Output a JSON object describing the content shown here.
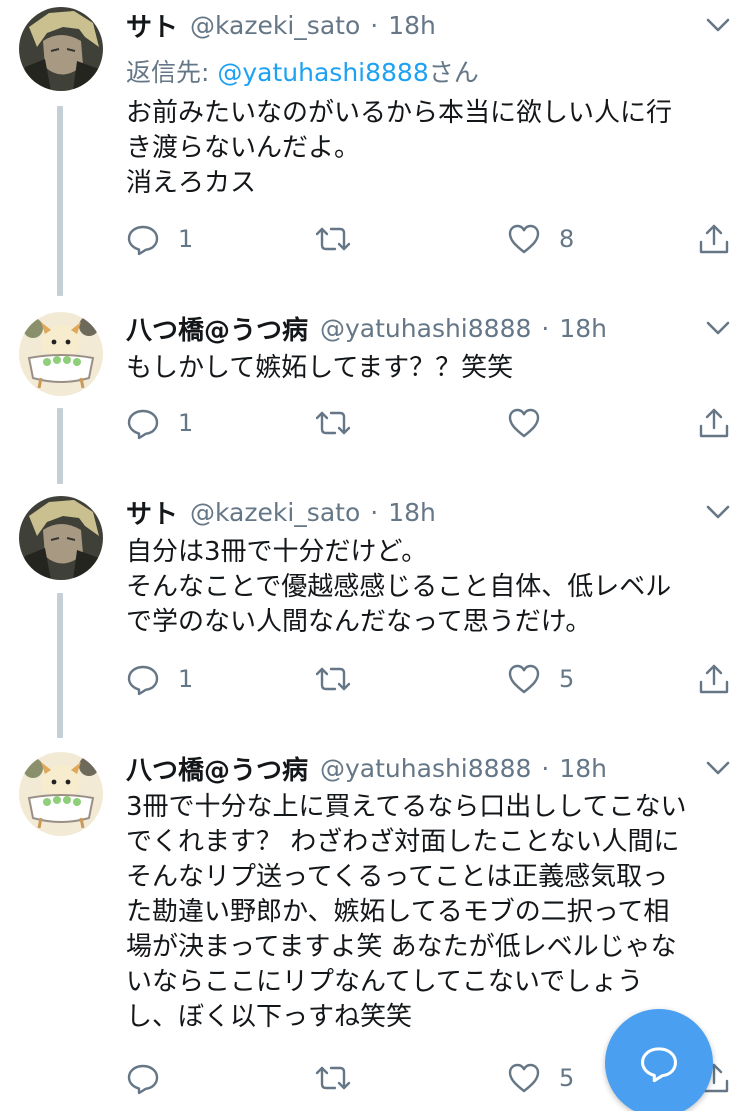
{
  "tweets": [
    {
      "display_name": "サト",
      "handle": "@kazeki_sato",
      "separator": "·",
      "time": "18h",
      "reply_to_prefix": "返信先: ",
      "reply_to_mention": "@yatuhashi8888",
      "reply_to_suffix": "さん",
      "text_lines": [
        "お前みたいなのがいるから本当に欲しい人に行",
        "き渡らないんだよ。",
        "消えろカス"
      ],
      "reply_count": "1",
      "retweet_count": "",
      "like_count": "8"
    },
    {
      "display_name": "八つ橋@うつ病",
      "handle": "@yatuhashi8888",
      "separator": "·",
      "time": "18h",
      "text_lines": [
        "もしかして嫉妬してます？？笑笑"
      ],
      "reply_count": "1",
      "retweet_count": "",
      "like_count": ""
    },
    {
      "display_name": "サト",
      "handle": "@kazeki_sato",
      "separator": "·",
      "time": "18h",
      "text_lines": [
        "自分は3冊で十分だけど。",
        "そんなことで優越感感じること自体、低レベル",
        "で学のない人間なんだなって思うだけ。"
      ],
      "reply_count": "1",
      "retweet_count": "",
      "like_count": "5"
    },
    {
      "display_name": "八つ橋@うつ病",
      "handle": "@yatuhashi8888",
      "separator": "·",
      "time": "18h",
      "text_lines": [
        "3冊で十分な上に買えてるなら口出ししてこない",
        "でくれます？ わざわざ対面したことない人間に",
        "そんなリプ送ってくるってことは正義感気取っ",
        "た勘違い野郎か、嫉妬してるモブの二択って相",
        "場が決まってますよ笑 あなたが低レベルじゃな",
        "いならここにリプなんてしてこないでしょう",
        "し、ぼく以下っすね笑笑"
      ],
      "reply_count": "",
      "retweet_count": "",
      "like_count": "5"
    }
  ],
  "colors": {
    "text": "#14171a",
    "secondary": "#657786",
    "link": "#1da1f2",
    "thread_line": "#c4cfd6",
    "fab": "#4a9ff0"
  },
  "icons": {
    "reply": "reply-icon",
    "retweet": "retweet-icon",
    "like": "heart-icon",
    "share": "share-icon",
    "more": "chevron-down-icon",
    "compose_reply": "compose-reply-icon"
  }
}
